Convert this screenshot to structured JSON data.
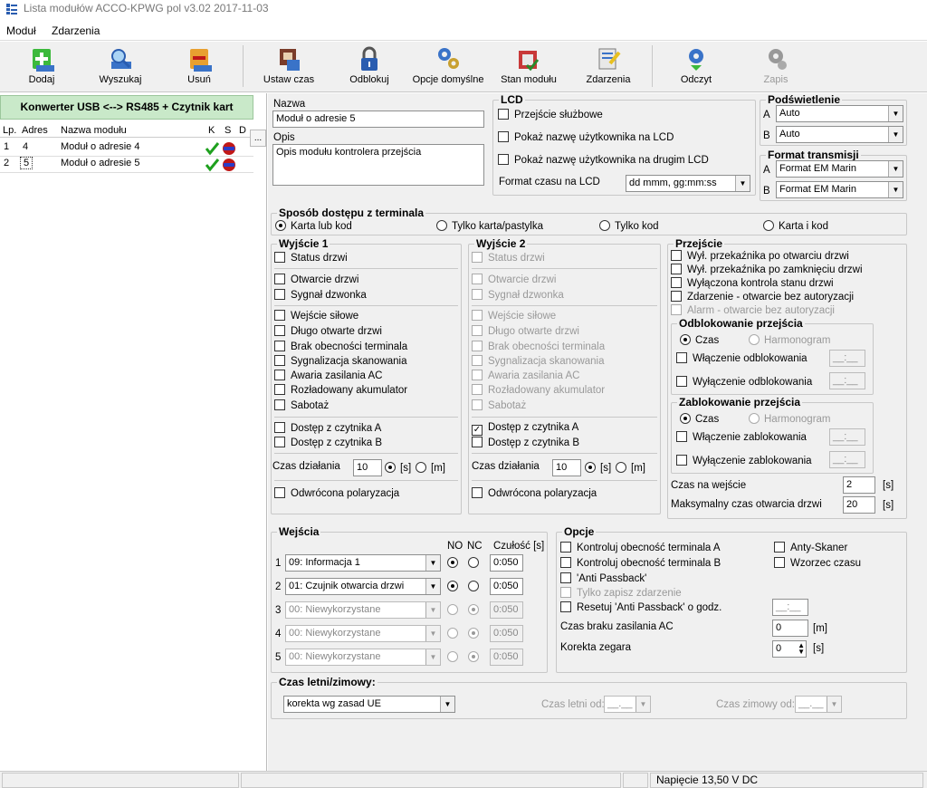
{
  "window": {
    "title": "Lista modułów  ACCO-KPWG   pol  v3.02  2017-11-03"
  },
  "menu": [
    "Moduł",
    "Zdarzenia"
  ],
  "toolbar": {
    "dodaj": "Dodaj",
    "wyszukaj": "Wyszukaj",
    "usun": "Usuń",
    "ustaw_czas": "Ustaw czas",
    "odblokuj": "Odblokuj",
    "opcje": "Opcje domyślne",
    "stan": "Stan modułu",
    "zdarzenia": "Zdarzenia",
    "odczyt": "Odczyt",
    "zapis": "Zapis"
  },
  "left": {
    "header": "Konwerter USB <--> RS485 + Czytnik kart",
    "cols": {
      "lp": "Lp.",
      "adres": "Adres",
      "nazwa": "Nazwa modułu",
      "k": "K",
      "s": "S",
      "d": "D"
    },
    "rows": [
      {
        "lp": "1",
        "adres": "4",
        "nazwa": "Moduł o adresie 4"
      },
      {
        "lp": "2",
        "adres": "5",
        "nazwa": "Moduł o adresie 5"
      }
    ]
  },
  "nazwa": {
    "label": "Nazwa",
    "value": "Moduł o adresie 5"
  },
  "opis": {
    "label": "Opis",
    "value": "Opis modułu kontrolera przejścia",
    "btn": "..."
  },
  "lcd": {
    "legend": "LCD",
    "opt1": "Przejście służbowe",
    "opt2": "Pokaż nazwę użytkownika na LCD",
    "opt3": "Pokaż nazwę użytkownika na drugim LCD",
    "format_label": "Format czasu na LCD",
    "format_value": "dd mmm, gg:mm:ss"
  },
  "podswietlenie": {
    "legend": "Podświetlenie",
    "a": "A",
    "a_val": "Auto",
    "b": "B",
    "b_val": "Auto"
  },
  "format": {
    "legend": "Format transmisji",
    "a": "A",
    "a_val": "Format EM Marin",
    "b": "B",
    "b_val": "Format EM Marin"
  },
  "dostep": {
    "legend": "Sposób dostępu z terminala",
    "opts": [
      "Karta lub kod",
      "Tylko karta/pastylka",
      "Tylko kod",
      "Karta i kod"
    ]
  },
  "wyjscie1": {
    "legend": "Wyjście 1",
    "items": [
      "Status drzwi",
      "Otwarcie drzwi",
      "Sygnał dzwonka",
      "Wejście siłowe",
      "Długo otwarte drzwi",
      "Brak obecności terminala",
      "Sygnalizacja skanowania",
      "Awaria zasilania AC",
      "Rozładowany akumulator",
      "Sabotaż",
      "Dostęp z czytnika A",
      "Dostęp z czytnika B"
    ],
    "czas_label": "Czas działania",
    "czas_value": "10",
    "s": "[s]",
    "m": "[m]",
    "polar": "Odwrócona polaryzacja"
  },
  "wyjscie2": {
    "legend": "Wyjście 2",
    "items": [
      "Status drzwi",
      "Otwarcie drzwi",
      "Sygnał dzwonka",
      "Wejście siłowe",
      "Długo otwarte drzwi",
      "Brak obecności terminala",
      "Sygnalizacja skanowania",
      "Awaria zasilania AC",
      "Rozładowany akumulator",
      "Sabotaż",
      "Dostęp z czytnika A",
      "Dostęp z czytnika B"
    ],
    "czas_label": "Czas działania",
    "czas_value": "10",
    "s": "[s]",
    "m": "[m]",
    "polar": "Odwrócona polaryzacja",
    "check": "✓"
  },
  "przejscie": {
    "legend": "Przejście",
    "items": [
      "Wył. przekaźnika po otwarciu drzwi",
      "Wył. przekaźnika po zamknięciu drzwi",
      "Wyłączona kontrola stanu drzwi",
      "Zdarzenie - otwarcie bez autoryzacji",
      "Alarm - otwarcie bez autoryzacji"
    ],
    "odblok": {
      "legend": "Odblokowanie przejścia",
      "czas": "Czas",
      "harmon": "Harmonogram",
      "wl": "Włączenie odblokowania",
      "wyl": "Wyłączenie odblokowania"
    },
    "zablok": {
      "legend": "Zablokowanie przejścia",
      "czas": "Czas",
      "harmon": "Harmonogram",
      "wl": "Włączenie zablokowania",
      "wyl": "Wyłączenie zablokowania"
    },
    "time_ph": "__:__",
    "wejscie_label": "Czas na wejście",
    "wejscie_val": "2",
    "maks_label": "Maksymalny czas otwarcia drzwi",
    "maks_val": "20",
    "s": "[s]"
  },
  "wejscia": {
    "legend": "Wejścia",
    "no": "NO",
    "nc": "NC",
    "czulosc": "Czułość [s]",
    "rows": [
      {
        "n": "1",
        "sel": "09: Informacja 1",
        "val": "0:050"
      },
      {
        "n": "2",
        "sel": "01: Czujnik otwarcia drzwi",
        "val": "0:050"
      },
      {
        "n": "3",
        "sel": "00: Niewykorzystane",
        "val": "0:050"
      },
      {
        "n": "4",
        "sel": "00: Niewykorzystane",
        "val": "0:050"
      },
      {
        "n": "5",
        "sel": "00: Niewykorzystane",
        "val": "0:050"
      }
    ]
  },
  "opcje": {
    "legend": "Opcje",
    "items": [
      "Kontroluj obecność terminala A",
      "Kontroluj obecność terminala B",
      "'Anti Passback'",
      "Tylko zapisz zdarzenie",
      "Resetuj 'Anti Passback' o godz."
    ],
    "anty": "Anty-Skaner",
    "wzorzec": "Wzorzec czasu",
    "ac_label": "Czas braku zasilania AC",
    "ac_val": "0",
    "ac_unit": "[m]",
    "korekta_label": "Korekta zegara",
    "korekta_val": "0",
    "korekta_unit": "[s]",
    "time_ph": "__:__"
  },
  "letni": {
    "legend": "Czas letni/zimowy:",
    "sel": "korekta wg zasad UE",
    "letni_od": "Czas letni od:",
    "zimowy_od": "Czas zimowy od:",
    "ph": "__.__"
  },
  "status": {
    "voltage": "Napięcie 13,50 V DC"
  }
}
